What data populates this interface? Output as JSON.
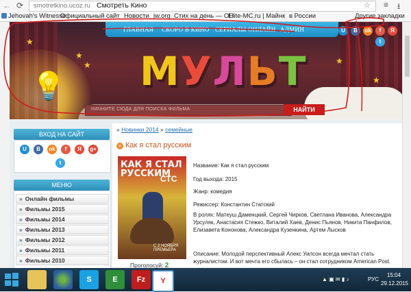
{
  "browser": {
    "url": "smotretkino.ucoz.ru",
    "title": "Смотреть Кино",
    "bookmarks": [
      "Jehovah's Witnesse",
      "Официальный сайт",
      "Новости",
      "jw.org",
      "Стих на день — ОН",
      "Elite-MC.ru | Майнк",
      "в России"
    ],
    "other_bookmarks": "Другие закладки"
  },
  "site": {
    "nav": [
      "ГЛАВНАЯ",
      "СКОРО В КИНО",
      "СЕРИАЛЫ ОНЛАЙН",
      "АДМИН"
    ],
    "logo": "МУЛЬТ",
    "logo_colors": [
      "#f0c61d",
      "#e94c3a",
      "#d74a9a",
      "#e77c27",
      "#7bc142"
    ],
    "search_placeholder": "НАЧНИТЕ СЮДА ДЛЯ ПОИСКА ФИЛЬМА",
    "search_button": "НАЙТИ",
    "social_icons": [
      {
        "name": "u-icon",
        "glyph": "U",
        "color": "#1f8fd0"
      },
      {
        "name": "vk-icon",
        "glyph": "B",
        "color": "#3f6ba3"
      },
      {
        "name": "odnoklassniki-icon",
        "glyph": "ok",
        "color": "#f48420"
      },
      {
        "name": "facebook-icon",
        "glyph": "f",
        "color": "#e15b46"
      },
      {
        "name": "yandex-icon",
        "glyph": "Я",
        "color": "#e44b3c"
      },
      {
        "name": "twitter-icon",
        "glyph": "t",
        "color": "#3aa7e2"
      }
    ]
  },
  "sidebar": {
    "login_title": "ВХОД НА САЙТ",
    "login_icons": [
      {
        "name": "u-icon",
        "glyph": "U",
        "color": "#1f8fd0"
      },
      {
        "name": "vk-icon",
        "glyph": "B",
        "color": "#3f6ba3"
      },
      {
        "name": "odnoklassniki-icon",
        "glyph": "ok",
        "color": "#f48420"
      },
      {
        "name": "facebook-icon",
        "glyph": "f",
        "color": "#e15b46"
      },
      {
        "name": "yandex-icon",
        "glyph": "Я",
        "color": "#e44b3c"
      },
      {
        "name": "google-plus-icon",
        "glyph": "g+",
        "color": "#dd4b39"
      },
      {
        "name": "twitter-icon",
        "glyph": "t",
        "color": "#3aa7e2"
      }
    ],
    "menu_title": "МЕНЮ",
    "menu_items": [
      "Онлайн фильмы",
      "Фильмы 2015",
      "Фильмы 2014",
      "Фильмы 2013",
      "Фильмы 2012",
      "Фильмы 2011",
      "Фильмы 2010"
    ]
  },
  "content": {
    "breadcrumb": [
      "Новинки 2014",
      "семейные"
    ],
    "film_title": "Как я стал русским",
    "poster_title": "КАК Я СТАЛ РУССКИМ",
    "poster_channel": "СТС",
    "poster_date": "С 2 НОЯБРЯ ПРЕМЬЕРА",
    "votes_label": "Проголосуй:",
    "votes_value": "2",
    "info": [
      "Название: Как я стал русским",
      "Год выхода: 2015",
      "Жанр: комедия",
      "Режиссер: Константин Статский"
    ],
    "cast": "В ролях: Матеуш Даменцкий, Сергей Чирков, Светлана Иванова, Александра Урсуляк, Анастасия Стежко, Виталий Хаев, Денис Пьянов, Никита Панфилов, Елизавета Кононова, Александра Кузенкина, Артем Лысков",
    "description": "Описание: Молодой перспективный Алекс Уилсон всегда мечтал стать журналистом. И вот мечта его сбылась – он стал сотрудником American Post. Совершенно случайно редакция решает отправить его в Россию по заданию. Алекс без ума от предстоящей поездки – ведь"
  },
  "taskbar": {
    "lang": "РУС",
    "time": "15:04",
    "date": "29.12.2015"
  }
}
